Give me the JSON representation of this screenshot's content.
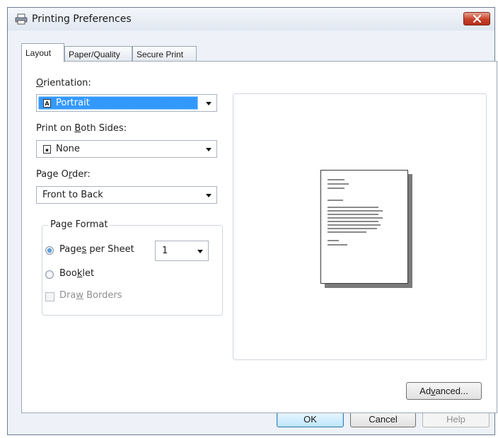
{
  "window": {
    "title": "Printing Preferences"
  },
  "tabs": [
    {
      "label": "Layout",
      "active": true
    },
    {
      "label": "Paper/Quality",
      "active": false
    },
    {
      "label": "Secure Print",
      "active": false
    }
  ],
  "orientation": {
    "label_prefix": "",
    "label_mnemonic": "O",
    "label_rest": "rientation:",
    "value": "Portrait",
    "icon": "A"
  },
  "both_sides": {
    "label_prefix": "Print on ",
    "label_mnemonic": "B",
    "label_rest": "oth Sides:",
    "value": "None"
  },
  "page_order": {
    "label_prefix": "Page O",
    "label_mnemonic": "r",
    "label_rest": "der:",
    "value": "Front to Back"
  },
  "page_format": {
    "title": "Page Format",
    "pages_per_sheet": {
      "prefix": "Page",
      "mnemonic": "s",
      "rest": " per Sheet",
      "value": "1",
      "checked": true
    },
    "booklet": {
      "prefix": "Boo",
      "mnemonic": "k",
      "rest": "let",
      "checked": false
    },
    "draw_borders": {
      "prefix": "Dra",
      "mnemonic": "w",
      "rest": " Borders",
      "checked": false,
      "enabled": false
    }
  },
  "buttons": {
    "advanced": {
      "prefix": "Ad",
      "mnemonic": "v",
      "rest": "anced..."
    },
    "ok": "OK",
    "cancel": "Cancel",
    "help": "Help"
  },
  "colors": {
    "selection": "#3399ff",
    "window_bg": "#eef2f8",
    "close": "#c7412a"
  }
}
